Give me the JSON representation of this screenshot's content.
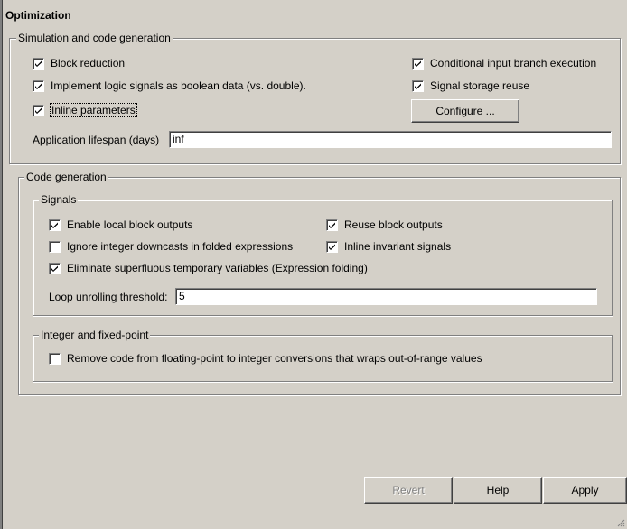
{
  "title": "Optimization",
  "sim_group": {
    "legend": "Simulation and code generation",
    "checkboxes": [
      {
        "label": "Block reduction",
        "checked": true
      },
      {
        "label": "Implement logic signals as boolean data (vs. double)",
        "checked": true
      },
      {
        "label": "Inline parameters",
        "checked": true
      },
      {
        "label": "Conditional input branch execution",
        "checked": true
      },
      {
        "label": "Signal storage reuse",
        "checked": true
      }
    ],
    "configure_label": "Configure ...",
    "lifespan_label": "Application lifespan (days)",
    "lifespan_value": "inf"
  },
  "codegen_group": {
    "legend": "Code generation",
    "signals": {
      "legend": "Signals",
      "checkboxes": [
        {
          "label": "Enable local block outputs",
          "checked": true
        },
        {
          "label": "Ignore integer downcasts in folded expressions",
          "checked": false
        },
        {
          "label": "Eliminate superfluous temporary variables (Expression folding)",
          "checked": true
        },
        {
          "label": "Reuse block outputs",
          "checked": true
        },
        {
          "label": "Inline invariant signals",
          "checked": true
        }
      ],
      "loop_label": "Loop unrolling threshold:",
      "loop_value": "5"
    },
    "integer": {
      "legend": "Integer and fixed-point",
      "checkboxes": [
        {
          "label": "Remove code from floating-point to integer conversions that wraps out-of-range values",
          "checked": false
        }
      ]
    }
  },
  "buttons": {
    "revert": "Revert",
    "help": "Help",
    "apply": "Apply"
  }
}
